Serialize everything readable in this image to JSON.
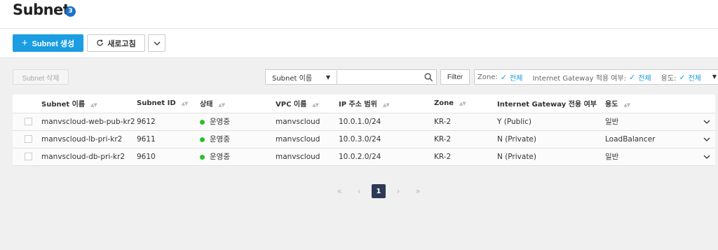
{
  "header": {
    "title": "Subnet",
    "count": "3"
  },
  "actions": {
    "create_label": "Subnet 생성",
    "refresh_label": "새로고침"
  },
  "toolbar": {
    "delete_label": "Subnet 삭제",
    "search_select_value": "Subnet 이름",
    "search_placeholder": "",
    "filter_label": "Filter",
    "filters": [
      {
        "label": "Zone:",
        "value": "전체"
      },
      {
        "label": "Internet Gateway 적용 여부:",
        "value": "전체"
      },
      {
        "label": "용도:",
        "value": "전체"
      }
    ]
  },
  "table": {
    "columns": [
      "Subnet 이름",
      "Subnet ID",
      "상태",
      "VPC 이름",
      "IP 주소 범위",
      "Zone",
      "Internet Gateway 전용 여부",
      "용도"
    ],
    "rows": [
      {
        "name": "manvscloud-web-pub-kr2",
        "id": "9612",
        "status": "운영중",
        "vpc": "manvscloud",
        "ip": "10.0.1.0/24",
        "zone": "KR-2",
        "igw": "Y (Public)",
        "usage": "일반"
      },
      {
        "name": "manvscloud-lb-pri-kr2",
        "id": "9611",
        "status": "운영중",
        "vpc": "manvscloud",
        "ip": "10.0.3.0/24",
        "zone": "KR-2",
        "igw": "N (Private)",
        "usage": "LoadBalancer"
      },
      {
        "name": "manvscloud-db-pri-kr2",
        "id": "9610",
        "status": "운영중",
        "vpc": "manvscloud",
        "ip": "10.0.2.0/24",
        "zone": "KR-2",
        "igw": "N (Private)",
        "usage": "일반"
      }
    ],
    "status_color": "#2bc02b"
  },
  "pagination": {
    "current_page": "1"
  },
  "colors": {
    "accent": "#1a9de2",
    "badge": "#1a73c9",
    "pager_active": "#2c3a57"
  }
}
